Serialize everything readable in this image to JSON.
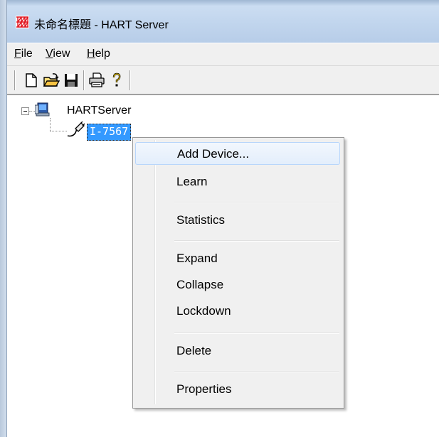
{
  "window": {
    "title": "未命名標題 - HART Server"
  },
  "menubar": {
    "items": [
      {
        "label_ul": "F",
        "label_rest": "ile"
      },
      {
        "label_ul": "V",
        "label_rest": "iew"
      },
      {
        "label_ul": "H",
        "label_rest": "elp"
      }
    ]
  },
  "toolbar": {
    "buttons": [
      "new-document-icon",
      "open-folder-icon",
      "save-disk-icon",
      "print-icon",
      "help-question-icon"
    ]
  },
  "tree": {
    "root": {
      "label": "HARTServer",
      "expanded": true
    },
    "child": {
      "label": "I-7567",
      "selected": true
    }
  },
  "context_menu": {
    "items": [
      {
        "label": "Add Device...",
        "highlighted": true
      },
      {
        "label": "Learn"
      },
      {
        "label": "Statistics"
      },
      {
        "label": "Expand"
      },
      {
        "label": "Collapse"
      },
      {
        "label": "Lockdown"
      },
      {
        "label": "Delete"
      },
      {
        "label": "Properties"
      }
    ]
  },
  "colors": {
    "titlebar": "#c2d6ee",
    "selection": "#3399ff",
    "menu_background": "#f0f0f0",
    "menu_highlight_border": "#b8d6fb"
  }
}
